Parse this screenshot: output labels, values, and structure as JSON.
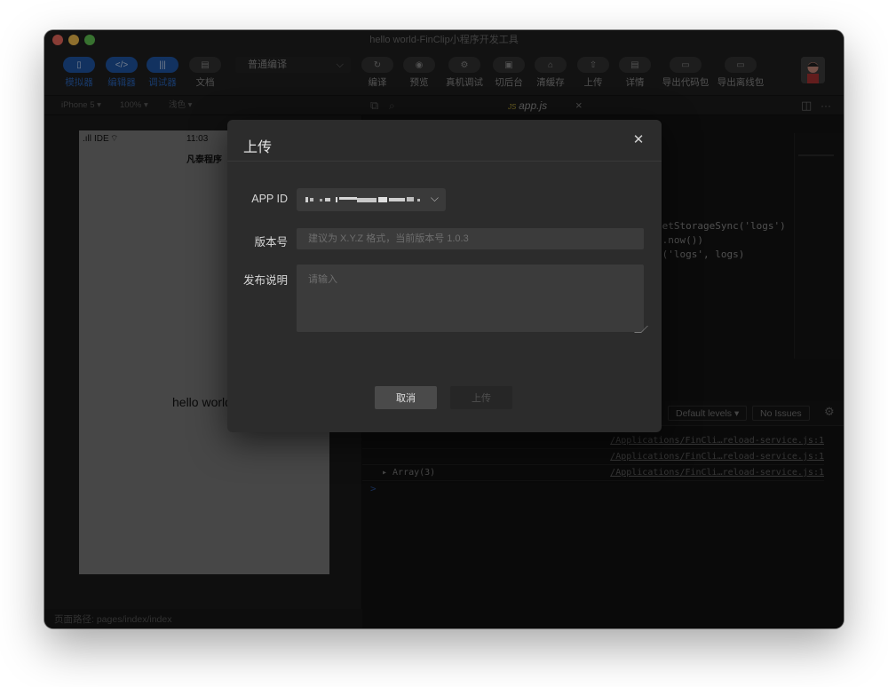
{
  "window": {
    "title": "hello world-FinClip小程序开发工具"
  },
  "toolbar": {
    "simulator": "模拟器",
    "editor": "编辑器",
    "debugger": "调试器",
    "docs": "文档",
    "compile_mode": "普通编译",
    "compile": "编译",
    "preview": "预览",
    "remote_debug": "真机调试",
    "background": "切后台",
    "clear_cache": "清缓存",
    "upload": "上传",
    "details": "详情",
    "export_code": "导出代码包",
    "export_offline": "导出离线包"
  },
  "simulator": {
    "device": "iPhone 5",
    "zoom": "100%",
    "theme": "浅色",
    "carrier": "IDE",
    "time": "11:03",
    "nav_title": "凡泰程序",
    "content": "hello world",
    "path_label": "页面路径: pages/index/index"
  },
  "editor": {
    "tab": "app.js",
    "code_lines": [
      "getStorageSync('logs')",
      "e.now())",
      "c('logs', logs)"
    ]
  },
  "console": {
    "levels": "Default levels ▾",
    "issues": "No Issues",
    "rows": [
      {
        "text": "",
        "src": "/Applications/FinCli…reload-service.js:1"
      },
      {
        "text": "",
        "src": "/Applications/FinCli…reload-service.js:1"
      },
      {
        "text": "▸ Array(3)",
        "src": "/Applications/FinCli…reload-service.js:1"
      }
    ],
    "prompt": ">"
  },
  "modal": {
    "title": "上传",
    "appid_label": "APP ID",
    "version_label": "版本号",
    "version_placeholder": "建议为 X.Y.Z 格式，当前版本号 1.0.3",
    "notes_label": "发布说明",
    "notes_placeholder": "请输入",
    "cancel": "取消",
    "submit": "上传"
  },
  "colors": {
    "accent": "#1f57a6",
    "modal_bg": "#2c2c2c",
    "overlay": "rgba(0,0,0,0.42)"
  },
  "icons": [
    "simulator-icon",
    "editor-icon",
    "debugger-icon",
    "docs-icon",
    "refresh-icon",
    "eye-icon",
    "gear-icon",
    "terminal-icon",
    "trash-icon",
    "upload-icon",
    "document-icon",
    "folder-icon",
    "close-icon",
    "chevron-down-icon"
  ]
}
